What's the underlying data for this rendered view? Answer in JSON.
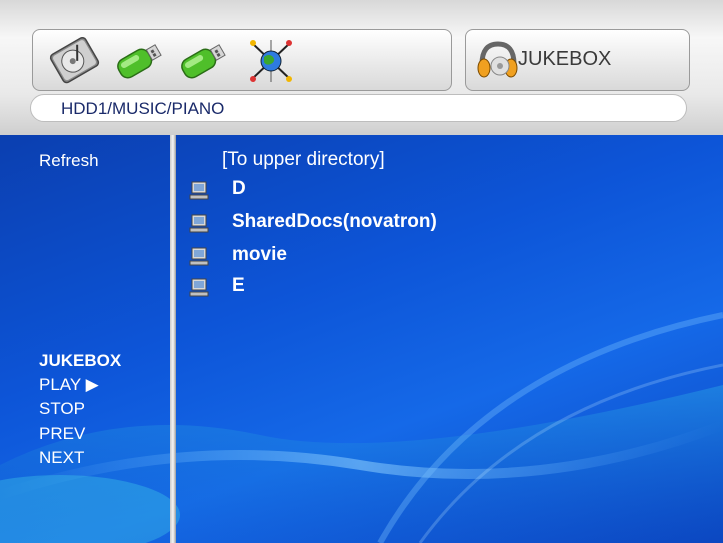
{
  "header": {
    "devices": [
      {
        "icon": "hard-disk-icon"
      },
      {
        "icon": "usb-drive-icon"
      },
      {
        "icon": "usb-drive-icon"
      },
      {
        "icon": "network-globe-icon"
      }
    ],
    "mode": {
      "icon": "headphones-icon",
      "label": "JUKEBOX"
    },
    "path": "HDD1/MUSIC/PIANO"
  },
  "sidebar": {
    "refresh_label": "Refresh",
    "jukebox_title": "JUKEBOX",
    "play_label": "PLAY ▶",
    "stop_label": "STOP",
    "prev_label": "PREV",
    "next_label": "NEXT"
  },
  "file_list": {
    "upper_label": "[To upper directory]",
    "items": [
      {
        "name": "D",
        "icon": "computer-icon"
      },
      {
        "name": "SharedDocs(novatron)",
        "icon": "computer-icon"
      },
      {
        "name": "movie",
        "icon": "computer-icon"
      },
      {
        "name": "E",
        "icon": "computer-icon"
      }
    ]
  },
  "colors": {
    "background_blue": "#0d55d8",
    "header_gray": "#e9e9e9",
    "path_text": "#1a2a6a",
    "text": "#ffffff"
  }
}
